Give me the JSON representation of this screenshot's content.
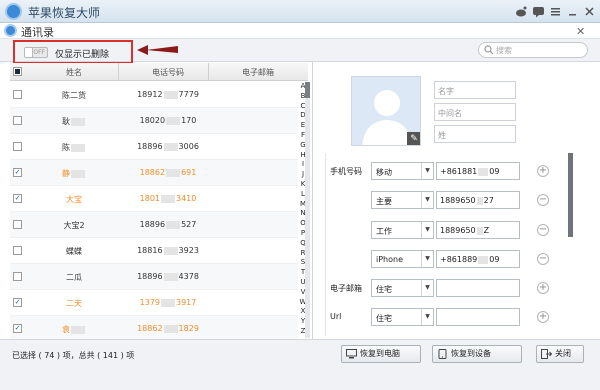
{
  "app": {
    "title": "苹果恢复大师"
  },
  "window": {
    "title": "通讯录"
  },
  "filter": {
    "toggle_text": "OFF",
    "label": "仅显示已删除",
    "search_placeholder": "搜索"
  },
  "table": {
    "headers": {
      "name": "姓名",
      "phone": "电话号码",
      "email": "电子邮箱"
    },
    "rows": [
      {
        "checked": false,
        "orange": false,
        "name": "陈二货",
        "phone_a": "18912",
        "phone_b": "7779"
      },
      {
        "checked": false,
        "orange": false,
        "name": "耿",
        "phone_a": "18020",
        "phone_b": "170"
      },
      {
        "checked": false,
        "orange": false,
        "name": "陈",
        "phone_a": "18896",
        "phone_b": "3006"
      },
      {
        "checked": true,
        "orange": true,
        "name": "静",
        "phone_a": "18862",
        "phone_b": "691"
      },
      {
        "checked": true,
        "orange": true,
        "name": "大宝",
        "phone_a": "1801",
        "phone_b": "3410"
      },
      {
        "checked": false,
        "orange": false,
        "name": "大宝2",
        "phone_a": "18896",
        "phone_b": "527"
      },
      {
        "checked": false,
        "orange": false,
        "name": "蝶蝶",
        "phone_a": "18816",
        "phone_b": "3923"
      },
      {
        "checked": false,
        "orange": false,
        "name": "二瓜",
        "phone_a": "18896",
        "phone_b": "4378"
      },
      {
        "checked": true,
        "orange": true,
        "name": "二天",
        "phone_a": "1379",
        "phone_b": "3917"
      },
      {
        "checked": true,
        "orange": true,
        "name": "袁",
        "phone_a": "18862",
        "phone_b": "1829"
      }
    ]
  },
  "index_letters": [
    "A",
    "B",
    "C",
    "D",
    "E",
    "F",
    "G",
    "H",
    "I",
    "J",
    "K",
    "L",
    "M",
    "N",
    "O",
    "P",
    "Q",
    "R",
    "S",
    "T",
    "U",
    "V",
    "W",
    "X",
    "Y",
    "Z"
  ],
  "detail": {
    "name_placeholders": {
      "first": "名字",
      "middle": "中间名",
      "last": "姓"
    },
    "phone_label": "手机号码",
    "email_label": "电子邮箱",
    "url_label": "Url",
    "phones": [
      {
        "type": "移动",
        "value_a": "+861881",
        "value_b": "09"
      },
      {
        "type": "主要",
        "value_a": "1889650",
        "value_b": "27"
      },
      {
        "type": "工作",
        "value_a": "1889650",
        "value_b": "Z"
      },
      {
        "type": "iPhone",
        "value_a": "+861889",
        "value_b": "09"
      }
    ],
    "email": {
      "type": "住宅"
    },
    "url": {
      "type": "住宅"
    }
  },
  "footer": {
    "status": "已选择 ( 74 ) 项，总共 ( 141 ) 项",
    "restore_computer": "恢复到电脑",
    "restore_device": "恢复到设备",
    "close": "关闭"
  },
  "colors": {
    "accent_red": "#d9302b",
    "deleted_orange": "#f08e2a",
    "brand_blue": "#3c8ad6"
  }
}
